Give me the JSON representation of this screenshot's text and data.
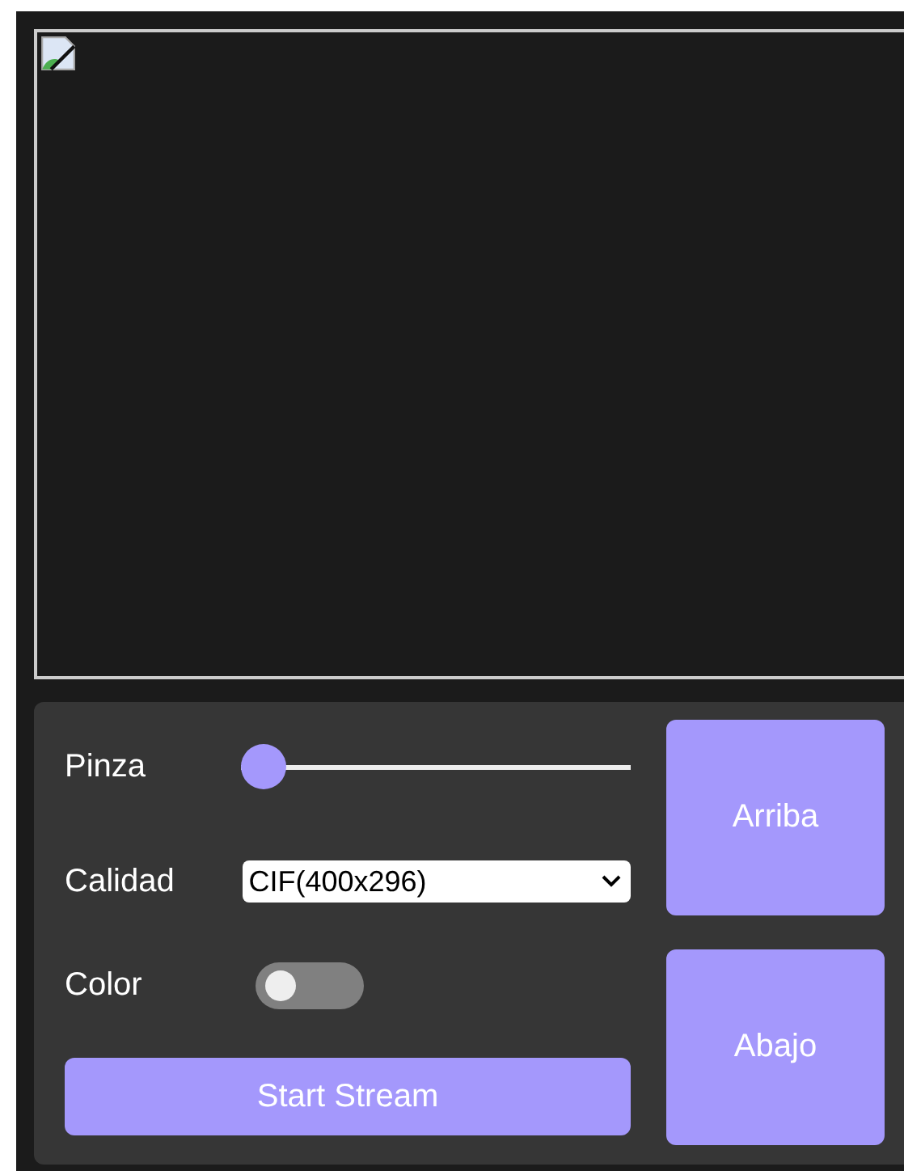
{
  "video": {
    "broken_image": true
  },
  "controls": {
    "pinza": {
      "label": "Pinza",
      "level": 0
    },
    "calidad": {
      "label": "Calidad",
      "value": "CIF(400x296)"
    },
    "color": {
      "label": "Color",
      "on": false
    },
    "start": {
      "label": "Start Stream"
    }
  },
  "buttons": [
    "Arriba",
    "Abajo"
  ]
}
